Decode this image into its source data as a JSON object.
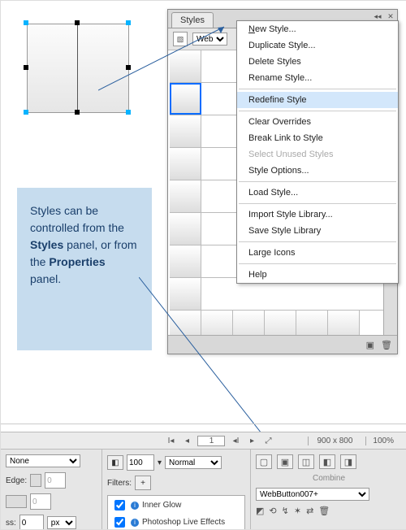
{
  "callout_parts": {
    "t1": "Styles can be controlled from the ",
    "b1": "Styles",
    "t2": " panel, or from the ",
    "b2": "Properties",
    "t3": " panel."
  },
  "styles_panel": {
    "tab": "Styles",
    "toolbar_dropdown": "Web",
    "footer": {
      "new_icon": "new-style-icon",
      "trash_icon": "trash-icon"
    }
  },
  "context_menu": {
    "items": [
      {
        "label": "New Style...",
        "mnemonic": "N"
      },
      {
        "label": "Duplicate Style..."
      },
      {
        "label": "Delete Styles"
      },
      {
        "label": "Rename Style..."
      },
      {
        "sep": true
      },
      {
        "label": "Redefine Style",
        "highlight": true
      },
      {
        "sep": true
      },
      {
        "label": "Clear Overrides"
      },
      {
        "label": "Break Link to Style"
      },
      {
        "label": "Select Unused Styles",
        "disabled": true
      },
      {
        "label": "Style Options..."
      },
      {
        "sep": true
      },
      {
        "label": "Load Style..."
      },
      {
        "sep": true
      },
      {
        "label": "Import Style Library..."
      },
      {
        "label": "Save Style Library"
      },
      {
        "sep": true
      },
      {
        "label": "Large Icons"
      },
      {
        "sep": true
      },
      {
        "label": "Help"
      }
    ]
  },
  "navbar": {
    "page": "1",
    "canvas_size": "900 x 800",
    "zoom": "100%"
  },
  "properties": {
    "state_select": "None",
    "edge_label": "Edge:",
    "edge_value": "0",
    "edge_extra": "0",
    "opacity": "100",
    "blend": "Normal",
    "filters_label": "Filters:",
    "filters": [
      "Inner Glow",
      "Photoshop Live Effects"
    ],
    "ss_label": "ss:",
    "ss_value": "0",
    "ss_unit": "px",
    "combine_label": "Combine",
    "style_select": "WebButton007+"
  }
}
